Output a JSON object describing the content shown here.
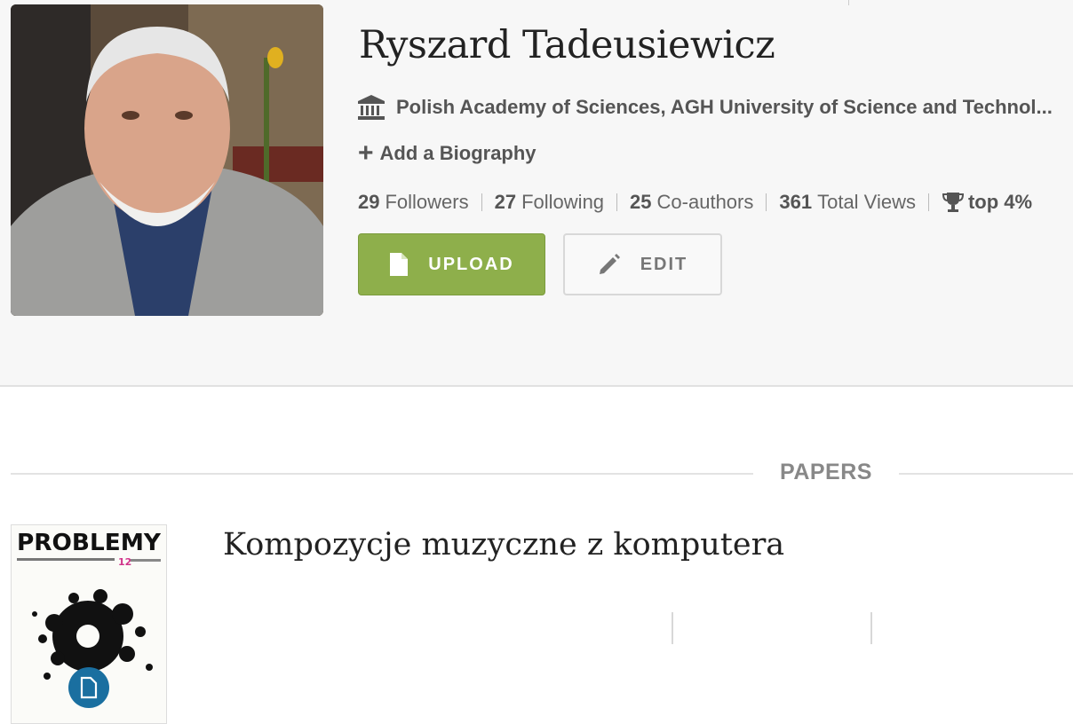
{
  "profile": {
    "name": "Ryszard Tadeusiewicz",
    "affiliation": "Polish Academy of Sciences, AGH University of Science and Technol...",
    "add_bio_label": "Add a Biography",
    "stats": [
      {
        "count": "29",
        "label": "Followers"
      },
      {
        "count": "27",
        "label": "Following"
      },
      {
        "count": "25",
        "label": "Co-authors"
      },
      {
        "count": "361",
        "label": "Total Views"
      }
    ],
    "rank_label": "top 4%",
    "upload_label": "UPLOAD",
    "edit_label": "EDIT"
  },
  "papers": {
    "heading": "PAPERS",
    "items": [
      {
        "title": "Kompozycje muzyczne z komputera",
        "thumbnail_text": "PROBLEMY",
        "thumbnail_issue": "12"
      }
    ]
  },
  "colors": {
    "upload_green": "#8eaf4b",
    "badge_blue": "#1a6fa0",
    "header_bg": "#f7f7f7"
  },
  "icons": [
    "bank-icon",
    "plus-icon",
    "trophy-icon",
    "file-icon",
    "pencil-icon",
    "document-icon"
  ]
}
